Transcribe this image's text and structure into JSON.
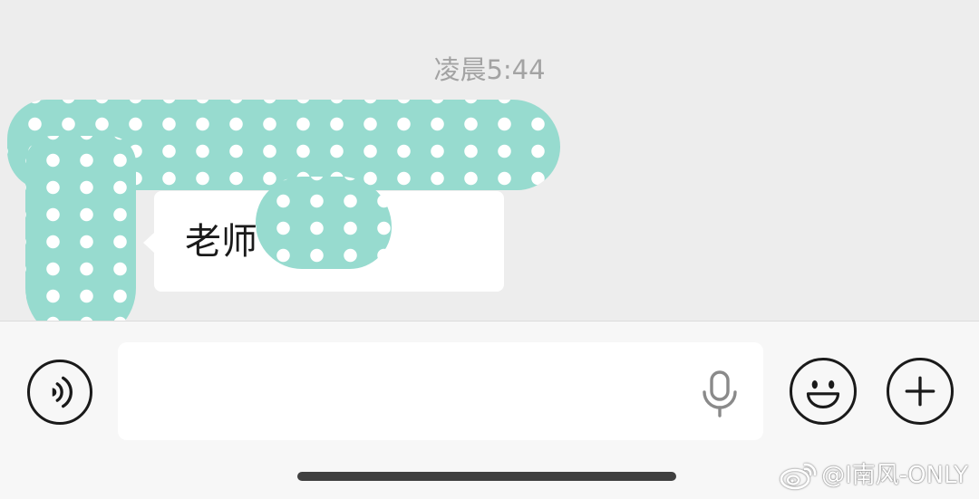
{
  "chat": {
    "timestamp": "凌晨5:44",
    "messages": [
      {
        "sender": "incoming",
        "text": "老师 请假",
        "redacted": true
      }
    ]
  },
  "input_bar": {
    "message_value": "",
    "icons": {
      "voice": "voice-input-icon",
      "mic": "mic-icon",
      "emoji": "emoji-icon",
      "plus": "plus-icon"
    }
  },
  "watermark": {
    "text": "@I南风-ONLY",
    "icon": "weibo-logo-icon"
  },
  "colors": {
    "background": "#ededed",
    "bubble": "#ffffff",
    "redaction": "#97dbcf",
    "icon": "#1a1a1a"
  }
}
